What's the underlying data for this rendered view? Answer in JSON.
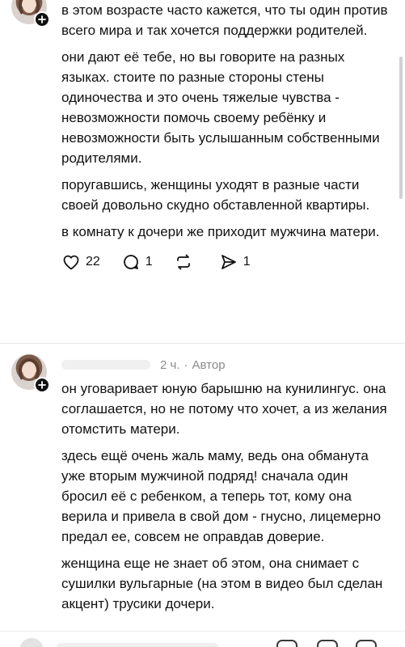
{
  "post1": {
    "paragraphs": [
      "в этом возрасте часто кажется, что ты один против всего мира и так хочется поддержки родителей.",
      "они дают её тебе, но вы говорите на разных языках. стоите по разные стороны стены одиночества и это очень тяжелые чувства - невозможности помочь своему ребёнку и невозможности быть услышанным собственными родителями.",
      "поругавшись, женщины уходят в разные части своей довольно скудно обставленной квартиры.",
      "в комнату к дочери же приходит мужчина матери."
    ],
    "actions": {
      "likes": "22",
      "replies": "1",
      "reposts": "",
      "shares": "1"
    }
  },
  "post2": {
    "time": "2 ч.",
    "separator": "·",
    "author_badge": "Автор",
    "paragraphs": [
      "он уговаривает юную барышню на кунилингус. она соглашается, но не потому что хочет, а из желания отомстить матери.",
      "здесь ещё очень жаль маму, ведь она обманута уже вторым мужчиной подряд! сначала один бросил её с ребенком, а теперь тот, кому она верила и привела в свой дом - гнусно, лицемерно предал ее, совсем не оправдав доверие.",
      "женщина еще не знает об этом, она снимает с сушилки вульгарные (на этом в видео был сделан акцент) трусики дочери."
    ]
  },
  "icons": {
    "like": "heart-icon",
    "reply": "comment-icon",
    "repost": "repost-icon",
    "share": "send-icon",
    "follow": "plus-icon"
  }
}
